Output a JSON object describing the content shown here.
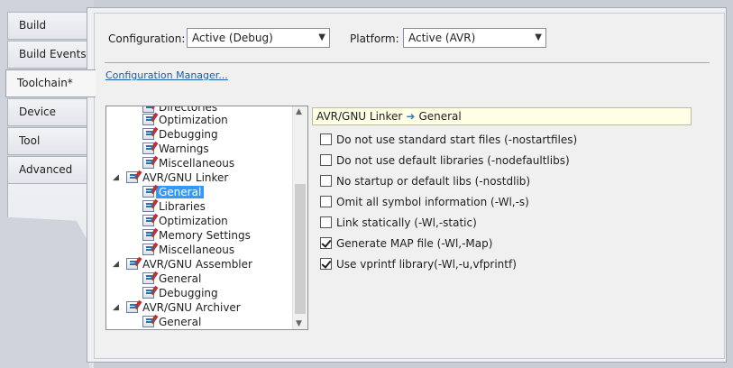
{
  "tabs": [
    {
      "label": "Build"
    },
    {
      "label": "Build Events"
    },
    {
      "label": "Toolchain*"
    },
    {
      "label": "Device"
    },
    {
      "label": "Tool"
    },
    {
      "label": "Advanced"
    }
  ],
  "config": {
    "configuration_label": "Configuration:",
    "configuration_value": "Active (Debug)",
    "platform_label": "Platform:",
    "platform_value": "Active (AVR)",
    "manager_link": "Configuration Manager..."
  },
  "tree": {
    "items": [
      {
        "label": "Directories"
      },
      {
        "label": "Optimization"
      },
      {
        "label": "Debugging"
      },
      {
        "label": "Warnings"
      },
      {
        "label": "Miscellaneous"
      },
      {
        "label": "AVR/GNU Linker"
      },
      {
        "label": "General"
      },
      {
        "label": "Libraries"
      },
      {
        "label": "Optimization"
      },
      {
        "label": "Memory Settings"
      },
      {
        "label": "Miscellaneous"
      },
      {
        "label": "AVR/GNU Assembler"
      },
      {
        "label": "General"
      },
      {
        "label": "Debugging"
      },
      {
        "label": "AVR/GNU Archiver"
      },
      {
        "label": "General"
      }
    ],
    "selected": "General"
  },
  "breadcrumb": {
    "parent": "AVR/GNU Linker",
    "child": "General",
    "arrow_icon": "arrow-right-icon"
  },
  "options": [
    {
      "label": "Do not use standard start files (-nostartfiles)",
      "checked": false
    },
    {
      "label": "Do not use default libraries (-nodefaultlibs)",
      "checked": false
    },
    {
      "label": "No startup or default libs (-nostdlib)",
      "checked": false
    },
    {
      "label": "Omit all symbol information (-Wl,-s)",
      "checked": false
    },
    {
      "label": "Link statically (-Wl,-static)",
      "checked": false
    },
    {
      "label": "Generate MAP file (-Wl,-Map)",
      "checked": true
    },
    {
      "label": "Use vprintf library(-Wl,-u,vfprintf)",
      "checked": true
    }
  ],
  "colors": {
    "selection": "#3399ff",
    "link": "#1a5ea8",
    "crumb_bg": "#ffffe6"
  }
}
